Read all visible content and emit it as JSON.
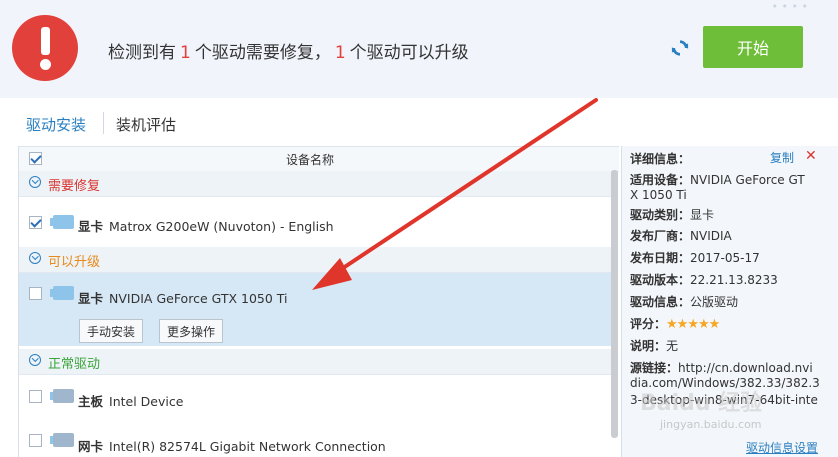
{
  "header": {
    "prefix": "检测到有",
    "repair_count": "1",
    "middle": "个驱动需要修复，",
    "upgrade_count": "1",
    "suffix": "个驱动可以升级",
    "start_label": "开始",
    "top_dots": "• • • •"
  },
  "tabs": [
    {
      "label": "驱动安装"
    },
    {
      "label": "装机评估"
    }
  ],
  "list": {
    "column_header": "设备名称",
    "groups": [
      {
        "title": "需要修复"
      },
      {
        "title": "可以升级"
      },
      {
        "title": "正常驱动"
      }
    ],
    "rows": [
      {
        "type": "显卡",
        "name": "Matrox G200eW (Nuvoton) - English",
        "checked": true,
        "icon": "gpu-icon",
        "icon_text": "GAME"
      },
      {
        "type": "显卡",
        "name": "NVIDIA GeForce GTX 1050 Ti",
        "checked": false,
        "icon": "gpu-icon",
        "icon_text": "GAME"
      },
      {
        "type": "主板",
        "name": "Intel Device",
        "checked": false,
        "icon": "motherboard-icon"
      },
      {
        "type": "网卡",
        "name": "Intel(R) 82574L Gigabit Network Connection",
        "checked": false,
        "icon": "network-icon"
      }
    ],
    "manual_install": "手动安装",
    "more_ops": "更多操作"
  },
  "detail": {
    "title": "详细信息：",
    "copy": "复制",
    "device_label": "适用设备：",
    "device_value_1": "NVIDIA GeForce GT",
    "device_value_2": "X 1050 Ti",
    "category_label": "驱动类别：",
    "category_value": "显卡",
    "vendor_label": "发布厂商：",
    "vendor_value": "NVIDIA",
    "date_label": "发布日期：",
    "date_value": "2017-05-17",
    "version_label": "驱动版本：",
    "version_value": "22.21.13.8233",
    "info_label": "驱动信息：",
    "info_value": "公版驱动",
    "rating_label": "评分：",
    "rating_stars": 5,
    "note_label": "说明：",
    "note_value": "无",
    "source_label": "源链接：",
    "source_1": "http://cn.download.nvi",
    "source_2": "dia.com/Windows/382.33/382.3",
    "source_3": "3-desktop-win8-win7-64bit-inte",
    "settings_link": "驱动信息设置",
    "watermark": "Baidu 经验",
    "watermark_sub": "jingyan.baidu.com"
  },
  "colors": {
    "accent": "#2a7fc0",
    "start_button": "#6fbe3a",
    "alert": "#e2403a",
    "arrow": "#e0352b"
  }
}
